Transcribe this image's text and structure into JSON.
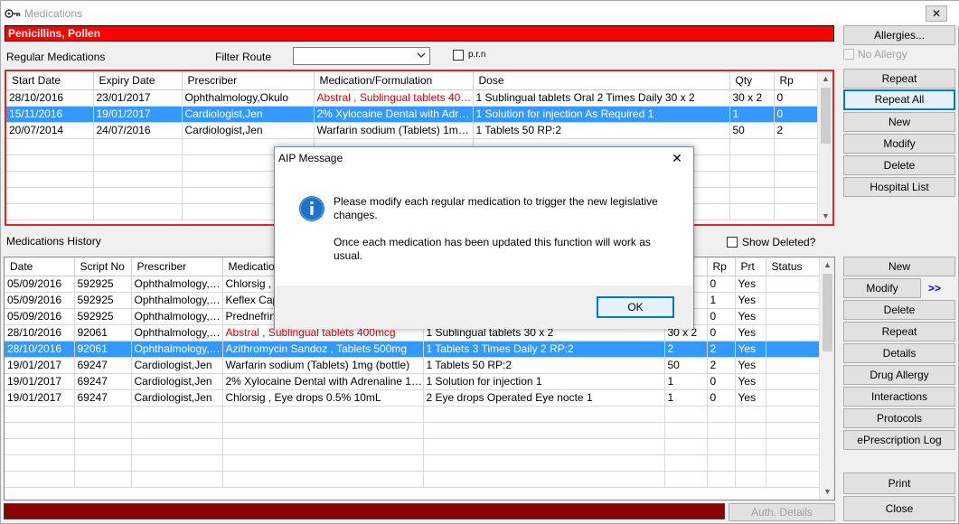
{
  "window": {
    "title": "Medications",
    "close_glyph": "✕"
  },
  "allergy_banner": "Penicillins, Pollen",
  "regular": {
    "label": "Regular Medications",
    "filter_route_label": "Filter Route",
    "filter_route_value": "",
    "prn_label": "p.r.n",
    "columns": [
      "Start Date",
      "Expiry Date",
      "Prescriber",
      "Medication/Formulation",
      "Dose",
      "Qty",
      "Rp"
    ],
    "rows": [
      [
        "28/10/2016",
        "23/01/2017",
        "Ophthalmology,Okulo",
        "Abstral , Sublingual tablets 400mcg",
        "1 Sublingual tablets Oral 2 Times Daily 30 x 2",
        "30 x 2",
        "0"
      ],
      [
        "15/11/2016",
        "19/01/2017",
        "Cardiologist,Jen",
        "2% Xylocaine Dental with Adrenal...",
        "1 Solution for injection As Required 1",
        "1",
        "0"
      ],
      [
        "20/07/2014",
        "24/07/2016",
        "Cardiologist,Jen",
        "Warfarin sodium (Tablets) 1mg (b...",
        "1 Tablets 50 RP:2",
        "50",
        "2"
      ]
    ],
    "selected_row": 1,
    "red_cells": [
      [
        0,
        3
      ]
    ]
  },
  "history": {
    "label": "Medications History",
    "show_deleted_label": "Show Deleted?",
    "columns": [
      "Date",
      "Script No",
      "Prescriber",
      "Medication",
      "",
      "",
      "Rp",
      "Prt",
      "Status"
    ],
    "rows": [
      [
        "05/09/2016",
        "592925",
        "Ophthalmology,O...",
        "Chlorsig , E",
        "",
        "",
        "0",
        "Yes",
        ""
      ],
      [
        "05/09/2016",
        "592925",
        "Ophthalmology,O...",
        "Keflex Cap",
        "",
        "",
        "1",
        "Yes",
        ""
      ],
      [
        "05/09/2016",
        "592925",
        "Ophthalmology,O...",
        "Prednefrin",
        "",
        "",
        "0",
        "Yes",
        ""
      ],
      [
        "28/10/2016",
        "92061",
        "Ophthalmology,O...",
        "Abstral , Sublingual tablets 400mcg",
        "1 Sublingual tablets 30 x 2",
        "30 x 2",
        "0",
        "Yes",
        ""
      ],
      [
        "28/10/2016",
        "92061",
        "Ophthalmology,O...",
        "Azithromycin Sandoz , Tablets 500mg",
        "1 Tablets 3 Times Daily 2 RP:2",
        "2",
        "2",
        "Yes",
        ""
      ],
      [
        "19/01/2017",
        "69247",
        "Cardiologist,Jen",
        "Warfarin sodium (Tablets) 1mg (bottle)",
        "1 Tablets 50 RP:2",
        "50",
        "2",
        "Yes",
        ""
      ],
      [
        "19/01/2017",
        "69247",
        "Cardiologist,Jen",
        "2% Xylocaine Dental with Adrenaline 1:80,0...",
        "1 Solution for injection 1",
        "1",
        "0",
        "Yes",
        ""
      ],
      [
        "19/01/2017",
        "69247",
        "Cardiologist,Jen",
        "Chlorsig , Eye drops 0.5% 10mL",
        "2 Eye drops Operated Eye nocte 1",
        "1",
        "0",
        "Yes",
        ""
      ]
    ],
    "selected_row": 4,
    "red_cells": [
      [
        3,
        3
      ]
    ]
  },
  "right_top_buttons": {
    "allergies": "Allergies...",
    "no_allergy": "No Allergy",
    "repeat": "Repeat",
    "repeat_all": "Repeat All",
    "new": "New",
    "modify": "Modify",
    "delete": "Delete",
    "hospital_list": "Hospital List"
  },
  "right_bottom_buttons": {
    "new": "New",
    "modify": "Modify",
    "more": ">>",
    "delete": "Delete",
    "repeat": "Repeat",
    "details": "Details",
    "drug_allergy": "Drug Allergy",
    "interactions": "Interactions",
    "protocols": "Protocols",
    "eprescription_log": "ePrescription Log",
    "print": "Print",
    "close": "Close",
    "auth_details": "Auth. Details"
  },
  "dialog": {
    "title": "AIP Message",
    "close_glyph": "✕",
    "line1": "Please modify each regular medication to trigger the new legislative",
    "line2": "changes.",
    "line3": "Once each medication has been updated this function will work as",
    "line4": "usual.",
    "ok": "OK",
    "icon": "info-icon"
  },
  "colors": {
    "accent": "#0078d7",
    "selected_row": "#3399ff",
    "allergy_red": "#ff0000",
    "status_red": "#8b0000"
  }
}
